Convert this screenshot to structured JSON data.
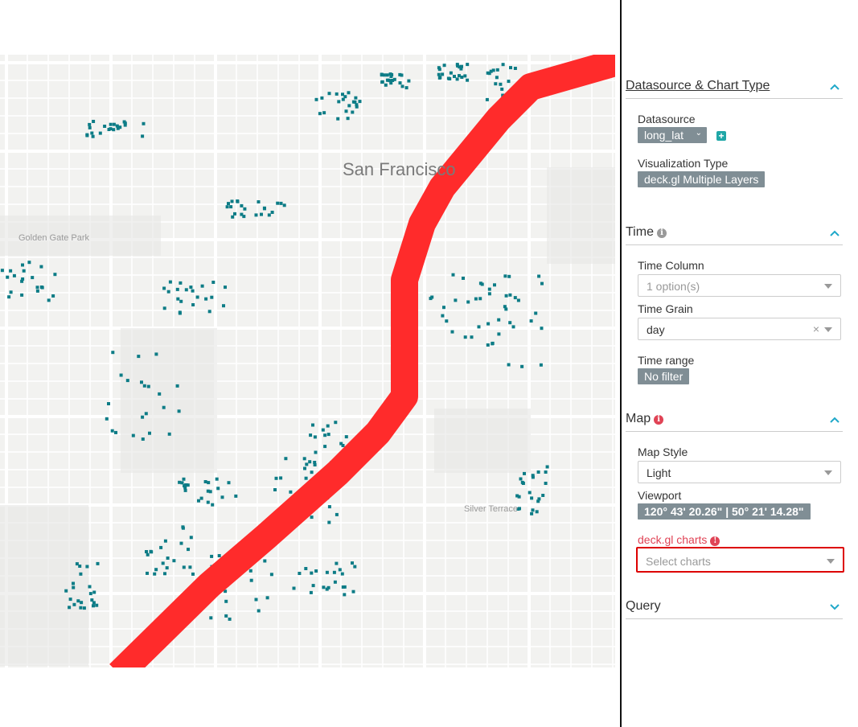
{
  "map": {
    "city_label": "San Francisco",
    "labels": [
      "Golden Gate Park",
      "Silver Terrace"
    ],
    "colors": {
      "background": "#f2f2f0",
      "road": "#ffffff",
      "park": "#e6e6e4",
      "points": "#0d7c86",
      "path": "#ff2b2b"
    }
  },
  "sections": {
    "datasource": {
      "title": "Datasource & Chart Type",
      "datasource_label": "Datasource",
      "datasource_value": "long_lat",
      "viz_label": "Visualization Type",
      "viz_value": "deck.gl Multiple Layers"
    },
    "time": {
      "title": "Time",
      "time_column_label": "Time Column",
      "time_column_placeholder": "1 option(s)",
      "time_grain_label": "Time Grain",
      "time_grain_value": "day",
      "time_range_label": "Time range",
      "time_range_value": "No filter"
    },
    "map": {
      "title": "Map",
      "map_style_label": "Map Style",
      "map_style_value": "Light",
      "viewport_label": "Viewport",
      "viewport_value": "120° 43' 20.26\" | 50° 21' 14.28\"",
      "charts_label": "deck.gl charts",
      "charts_placeholder": "Select charts"
    },
    "query": {
      "title": "Query"
    }
  },
  "icons": {
    "collapse": "chevron-up-icon",
    "expand": "chevron-down-icon",
    "info": "info-icon",
    "error": "error-icon",
    "add": "plus-icon"
  },
  "accent": "#1fa8c9",
  "error_color": "#e04355"
}
